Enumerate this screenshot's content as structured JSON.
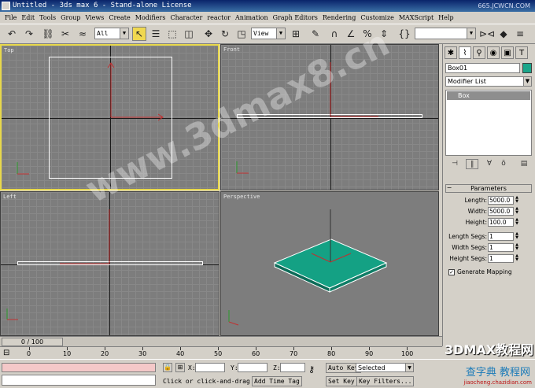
{
  "window": {
    "title": "Untitled - 3ds max 6 - Stand-alone License",
    "site_watermark": "665.JCWCN.COM"
  },
  "menu": [
    "File",
    "Edit",
    "Tools",
    "Group",
    "Views",
    "Create",
    "Modifiers",
    "Character",
    "reactor",
    "Animation",
    "Graph Editors",
    "Rendering",
    "Customize",
    "MAXScript",
    "Help"
  ],
  "toolbar": {
    "selection_filter": "All",
    "reference_coord": "View"
  },
  "viewports": {
    "top": "Top",
    "front": "Front",
    "left": "Left",
    "perspective": "Perspective"
  },
  "command_panel": {
    "object_name": "Box01",
    "object_color": "#1ba68a",
    "modifier_list": "Modifier List",
    "stack_item": "Box",
    "rollout_title": "Parameters",
    "params": [
      {
        "label": "Length:",
        "value": "5000.0"
      },
      {
        "label": "Width:",
        "value": "5000.0"
      },
      {
        "label": "Height:",
        "value": "100.0"
      },
      {
        "label": "Length Segs:",
        "value": "1"
      },
      {
        "label": "Width Segs:",
        "value": "1"
      },
      {
        "label": "Height Segs:",
        "value": "1"
      }
    ],
    "generate_mapping": "Generate Mapping"
  },
  "timeline": {
    "frame_display": "0 / 100",
    "ticks": [
      "0",
      "10",
      "20",
      "30",
      "40",
      "50",
      "60",
      "70",
      "80",
      "90",
      "100"
    ]
  },
  "status": {
    "x_label": "X:",
    "y_label": "Y:",
    "z_label": "Z:",
    "prompt": "Click or click-and-drag",
    "add_time_tag": "Add Time Tag",
    "auto_key": "Auto Key",
    "selected": "Selected",
    "set_key": "Set Key",
    "key_filters": "Key Filters..."
  },
  "watermarks": {
    "center": "www.3dmax8.cn",
    "bottom_right": "3DMAX教程网",
    "bottom_right_2": "查字典 教程网",
    "bottom_right_3": "jiaocheng.chazidian.com"
  }
}
